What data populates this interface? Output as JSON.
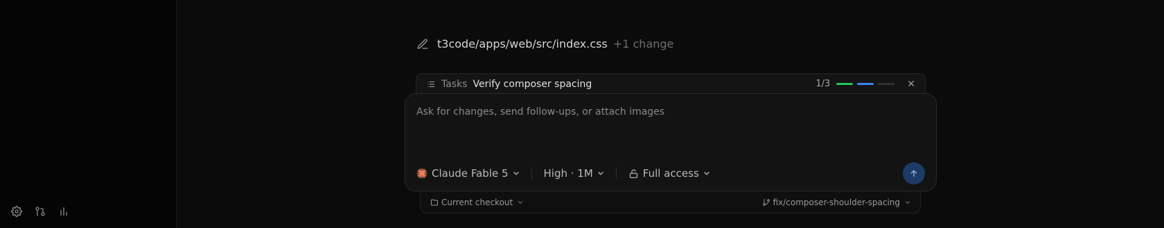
{
  "sidebar": {
    "footer_icons": [
      "settings-icon",
      "git-compare-icon",
      "bar-chart-icon"
    ]
  },
  "change_summary": {
    "icon": "pencil-icon",
    "file": "t3code/apps/web/src/index.css",
    "extra": "+1 change"
  },
  "tasks": {
    "label": "Tasks",
    "current": "Verify composer spacing",
    "count": "1/3",
    "progress": [
      {
        "state": "done",
        "color": "#22c55e"
      },
      {
        "state": "active",
        "color": "#3b82f6"
      },
      {
        "state": "pending",
        "color": "#333333"
      }
    ],
    "close_icon": "close-icon"
  },
  "composer": {
    "placeholder": "Ask for changes, send follow-ups, or attach images",
    "value": "",
    "model": "Claude Fable 5",
    "model_icon_color": "#e8805a",
    "effort": "High · 1M",
    "access": "Full access",
    "send_color": "#1e3a66"
  },
  "context": {
    "checkout": "Current checkout",
    "branch": "fix/composer-shoulder-spacing"
  }
}
